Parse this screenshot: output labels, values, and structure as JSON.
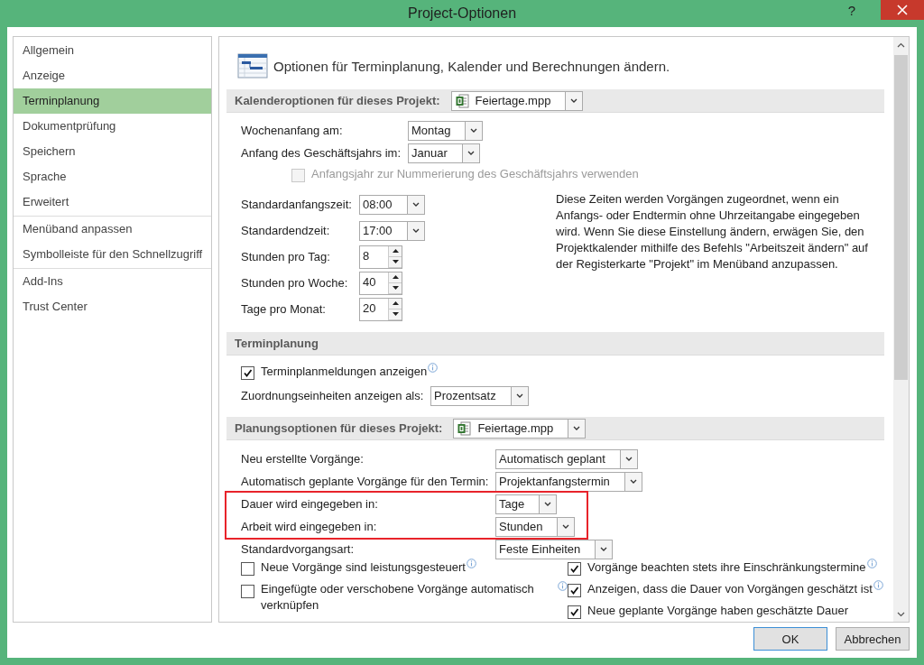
{
  "window": {
    "title": "Project-Optionen",
    "help": "?"
  },
  "sidebar": {
    "groups": [
      {
        "items": [
          {
            "label": "Allgemein",
            "selected": false
          },
          {
            "label": "Anzeige",
            "selected": false
          },
          {
            "label": "Terminplanung",
            "selected": true
          },
          {
            "label": "Dokumentprüfung",
            "selected": false
          },
          {
            "label": "Speichern",
            "selected": false
          },
          {
            "label": "Sprache",
            "selected": false
          },
          {
            "label": "Erweitert",
            "selected": false
          }
        ]
      },
      {
        "items": [
          {
            "label": "Menüband anpassen",
            "selected": false
          },
          {
            "label": "Symbolleiste für den Schnellzugriff",
            "selected": false
          }
        ]
      },
      {
        "items": [
          {
            "label": "Add-Ins",
            "selected": false
          },
          {
            "label": "Trust Center",
            "selected": false
          }
        ]
      }
    ]
  },
  "header": {
    "title": "Optionen für Terminplanung, Kalender und Berechnungen ändern."
  },
  "sections": [
    {
      "title": "Kalenderoptionen für dieses Projekt:",
      "project": "Feiertage.mpp",
      "blocks": [
        {
          "kind": "form",
          "rows": [
            {
              "kind": "dropdown",
              "label": "Wochenanfang am:",
              "value": "Montag",
              "highlighted": false
            },
            {
              "kind": "dropdown",
              "label": "Anfang des Geschäftsjahrs im:",
              "value": "Januar",
              "highlighted": false
            }
          ]
        },
        {
          "kind": "checkbox",
          "label": "Anfangsjahr zur Nummerierung des Geschäftsjahrs verwenden",
          "checked": false,
          "disabled": true,
          "info": false
        },
        {
          "kind": "split",
          "rows": [
            {
              "kind": "dropdown",
              "label": "Standardanfangszeit:",
              "value": "08:00",
              "highlighted": false
            },
            {
              "kind": "dropdown",
              "label": "Standardendzeit:",
              "value": "17:00",
              "highlighted": false
            },
            {
              "kind": "spinner",
              "label": "Stunden pro Tag:",
              "value": "8",
              "highlighted": false
            },
            {
              "kind": "spinner",
              "label": "Stunden pro Woche:",
              "value": "40",
              "highlighted": false
            },
            {
              "kind": "spinner",
              "label": "Tage pro Monat:",
              "value": "20",
              "highlighted": false
            }
          ],
          "note": "Diese Zeiten werden Vorgängen zugeordnet, wenn ein Anfangs- oder Endtermin ohne Uhrzeitangabe eingegeben wird. Wenn Sie diese Einstellung ändern, erwägen Sie, den Projektkalender mithilfe des Befehls \"Arbeitszeit ändern\" auf der Registerkarte \"Projekt\" im Menüband anzupassen."
        }
      ]
    },
    {
      "title": "Terminplanung",
      "blocks": [
        {
          "kind": "checkbox",
          "label": "Terminplanmeldungen anzeigen",
          "checked": true,
          "disabled": false,
          "info": true
        },
        {
          "kind": "form",
          "rows": [
            {
              "kind": "dropdown",
              "label": "Zuordnungseinheiten anzeigen als:",
              "value": "Prozentsatz",
              "highlighted": false
            }
          ]
        }
      ]
    },
    {
      "title": "Planungsoptionen für dieses Projekt:",
      "project": "Feiertage.mpp",
      "blocks": [
        {
          "kind": "form",
          "rows": [
            {
              "kind": "dropdown",
              "label": "Neu erstellte Vorgänge:",
              "value": "Automatisch geplant",
              "highlighted": false
            },
            {
              "kind": "dropdown",
              "label": "Automatisch geplante Vorgänge für den Termin:",
              "value": "Projektanfangstermin",
              "highlighted": false
            },
            {
              "kind": "dropdown",
              "label": "Dauer wird eingegeben in:",
              "value": "Tage",
              "highlighted": true
            },
            {
              "kind": "dropdown",
              "label": "Arbeit wird eingegeben in:",
              "value": "Stunden",
              "highlighted": true
            },
            {
              "kind": "dropdown",
              "label": "Standardvorgangsart:",
              "value": "Feste Einheiten",
              "highlighted": false
            }
          ]
        },
        {
          "kind": "columns",
          "columns": [
            {
              "items": [
                {
                  "label": "Neue Vorgänge sind leistungsgesteuert",
                  "checked": false,
                  "disabled": false,
                  "info": true
                },
                {
                  "label": "Eingefügte oder verschobene Vorgänge automatisch verknüpfen",
                  "checked": false,
                  "disabled": false,
                  "info": true
                }
              ]
            },
            {
              "items": [
                {
                  "label": "Vorgänge beachten stets ihre Einschränkungstermine",
                  "checked": true,
                  "disabled": false,
                  "info": true
                },
                {
                  "label": "Anzeigen, dass die Dauer von Vorgängen geschätzt ist",
                  "checked": true,
                  "disabled": false,
                  "info": true
                },
                {
                  "label": "Neue geplante Vorgänge haben geschätzte Dauer",
                  "checked": true,
                  "disabled": false,
                  "info": false
                }
              ]
            }
          ]
        }
      ]
    }
  ],
  "buttons": [
    {
      "label": "OK",
      "default": true
    },
    {
      "label": "Abbrechen",
      "default": false
    }
  ]
}
